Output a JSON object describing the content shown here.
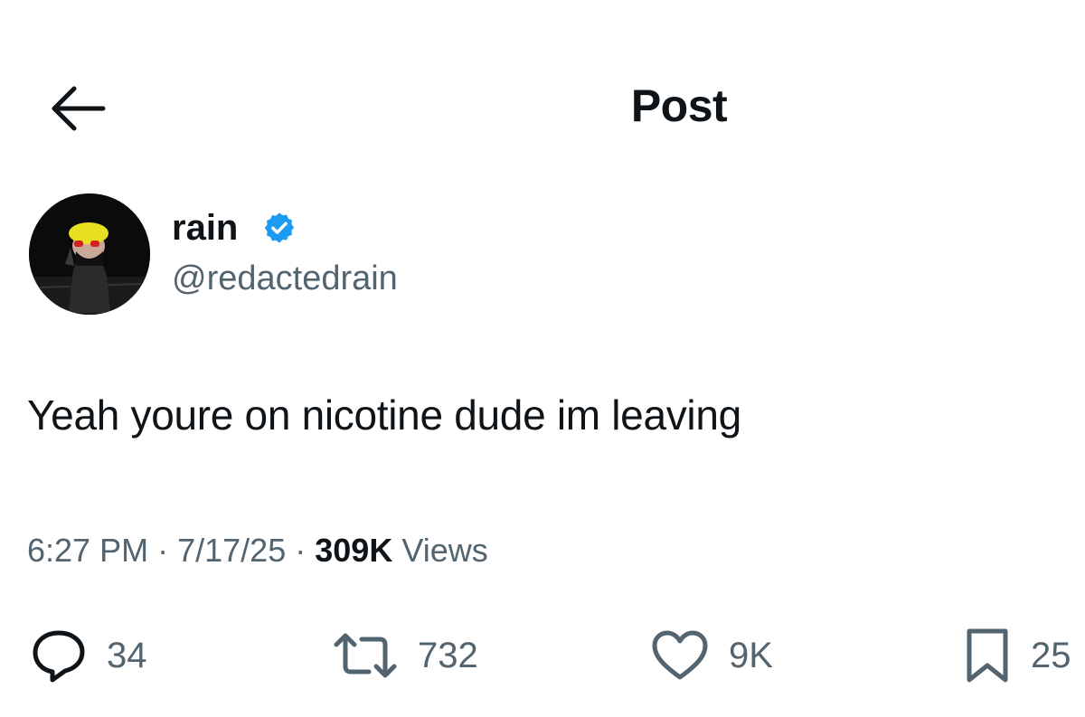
{
  "header": {
    "title": "Post",
    "back_icon": "arrow-left-icon"
  },
  "author": {
    "display_name": "rain",
    "handle": "@redactedrain",
    "verified_icon": "verified-badge-icon",
    "verified_color": "#1d9bf0"
  },
  "post": {
    "text": "Yeah youre on nicotine dude im leaving",
    "time": "6:27 PM",
    "date": "7/17/25",
    "views_count": "309K",
    "views_label": "Views",
    "separator": "·"
  },
  "actions": {
    "reply": {
      "icon": "reply-icon",
      "count": "34"
    },
    "repost": {
      "icon": "repost-icon",
      "count": "732"
    },
    "like": {
      "icon": "heart-icon",
      "count": "9K"
    },
    "bookmark": {
      "icon": "bookmark-icon",
      "count": "25"
    }
  },
  "colors": {
    "text": "#0f1419",
    "secondary": "#536471",
    "accent": "#1d9bf0"
  }
}
